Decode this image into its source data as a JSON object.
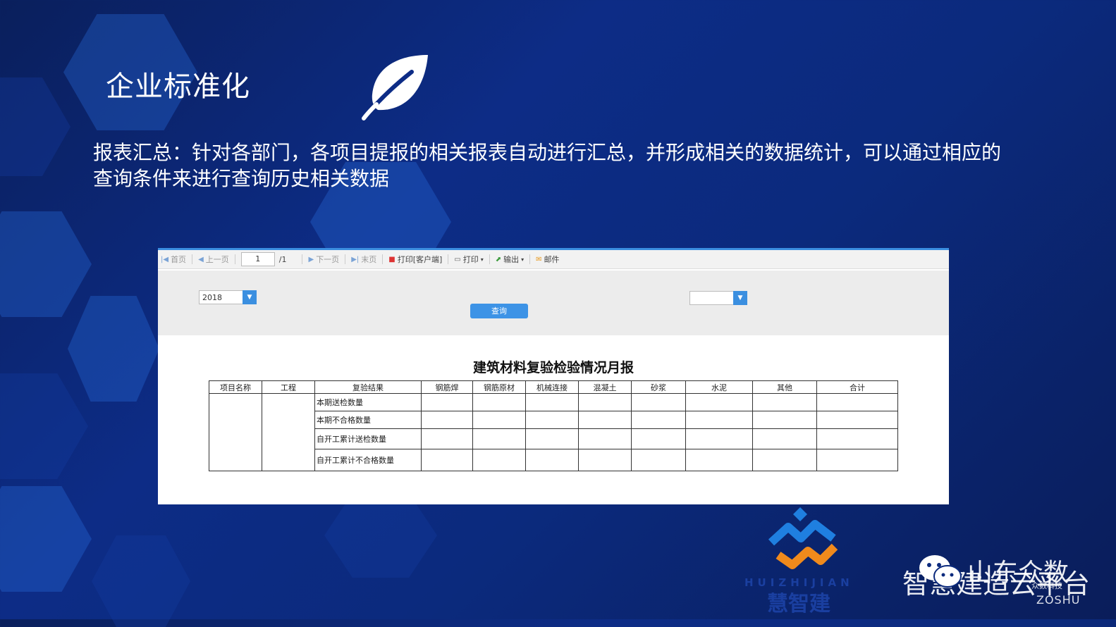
{
  "slide": {
    "title": "企业标准化",
    "description": "报表汇总：针对各部门，各项目提报的相关报表自动进行汇总，并形成相关的数据统计，可以通过相应的查询条件来进行查询历史相关数据"
  },
  "toolbar": {
    "first": "首页",
    "prev": "上一页",
    "page_value": "1",
    "page_total": "/1",
    "next": "下一页",
    "last": "末页",
    "print_client": "打印[客户端]",
    "print": "打印",
    "export": "输出",
    "mail": "邮件"
  },
  "filters": {
    "year_value": "2018",
    "right_select_value": "",
    "query_button": "查询"
  },
  "report": {
    "title": "建筑材料复验检验情况月报",
    "columns": [
      "项目名称",
      "工程",
      "复验结果",
      "钢筋焊",
      "钢筋原材",
      "机械连接",
      "混凝土",
      "砂浆",
      "水泥",
      "其他",
      "合计"
    ],
    "row_labels": [
      "本期送检数量",
      "本期不合格数量",
      "自开工累计送检数量",
      "自开工累计不合格数量"
    ]
  },
  "branding": {
    "logo_en": "HUIZHIJIAN",
    "logo_cn": "慧智建",
    "watermark_main": "智慧建造云平台",
    "watermark_overlay": "山东众数",
    "watermark_small": "众数科技",
    "watermark_zoshu": "ZOSHU"
  },
  "colors": {
    "background": "#0b2a7d",
    "accent_blue": "#3d93e6",
    "logo_blue": "#1f7fe0",
    "logo_orange": "#f08a1c"
  }
}
